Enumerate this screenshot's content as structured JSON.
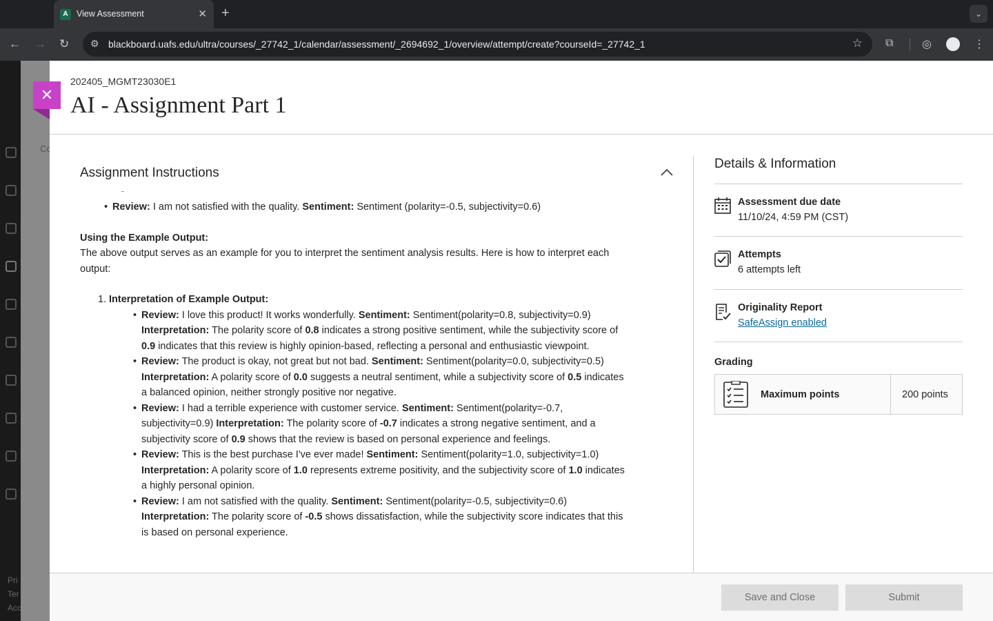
{
  "browser": {
    "tab_title": "View Assessment",
    "favicon_letter": "A",
    "url": "blackboard.uafs.edu/ultra/courses/_27742_1/calendar/assessment/_2694692_1/overview/attempt/create?courseId=_27742_1"
  },
  "background": {
    "side_letters": [
      "Pri",
      "Ter",
      "Acc"
    ],
    "strip_label": "Co"
  },
  "page": {
    "course_code": "202405_MGMT23030E1",
    "title": "AI - Assignment Part 1"
  },
  "instructions": {
    "section_title": "Assignment Instructions",
    "top_item": {
      "review_label": "Review:",
      "review_text": " I am not satisfied with the quality. ",
      "sentiment_label": "Sentiment:",
      "sentiment_text": " Sentiment (polarity=-0.5, subjectivity=0.6)"
    },
    "using_heading": "Using the Example Output:",
    "using_text": "The above output serves as an example for you to interpret the sentiment analysis results. Here is how to interpret each output:",
    "list_number": "1.",
    "list_heading": "Interpretation of Example Output:",
    "items": [
      {
        "review_label": "Review:",
        "review": " I love this product! It works wonderfully. ",
        "sentiment_label": "Sentiment:",
        "sentiment": " Sentiment(polarity=0.8, subjectivity=0.9) ",
        "interp_label": "Interpretation:",
        "t1": " The polarity score of ",
        "v1": "0.8",
        "t2": " indicates a strong positive sentiment, while the subjectivity score of ",
        "v2": "0.9",
        "t3": " indicates that this review is highly opinion-based, reflecting a personal and enthusiastic viewpoint."
      },
      {
        "review_label": "Review:",
        "review": " The product is okay, not great but not bad. ",
        "sentiment_label": "Sentiment:",
        "sentiment": " Sentiment(polarity=0.0, subjectivity=0.5) ",
        "interp_label": "Interpretation:",
        "t1": " A polarity score of ",
        "v1": "0.0",
        "t2": " suggests a neutral sentiment, while a subjectivity score of ",
        "v2": "0.5",
        "t3": " indicates a balanced opinion, neither strongly positive nor negative."
      },
      {
        "review_label": "Review:",
        "review": " I had a terrible experience with customer service. ",
        "sentiment_label": "Sentiment:",
        "sentiment": " Sentiment(polarity=-0.7, subjectivity=0.9) ",
        "interp_label": "Interpretation:",
        "t1": " The polarity score of ",
        "v1": "-0.7",
        "t2": " indicates a strong negative sentiment, and a subjectivity score of ",
        "v2": "0.9",
        "t3": " shows that the review is based on personal experience and feelings."
      },
      {
        "review_label": "Review:",
        "review": " This is the best purchase I've ever made! ",
        "sentiment_label": "Sentiment:",
        "sentiment": " Sentiment(polarity=1.0, subjectivity=1.0) ",
        "interp_label": "Interpretation:",
        "t1": " A polarity score of ",
        "v1": "1.0",
        "t2": " represents extreme positivity, and the subjectivity score of ",
        "v2": "1.0",
        "t3": " indicates a highly personal opinion."
      },
      {
        "review_label": "Review:",
        "review": " I am not satisfied with the quality. ",
        "sentiment_label": "Sentiment:",
        "sentiment": " Sentiment(polarity=-0.5, subjectivity=0.6) ",
        "interp_label": "Interpretation:",
        "t1": " The polarity score of ",
        "v1": "-0.5",
        "t2": " shows dissatisfaction, while the subjectivity score indicates that this is based on personal experience.",
        "v2": "",
        "t3": ""
      }
    ]
  },
  "details": {
    "title": "Details & Information",
    "due_label": "Assessment due date",
    "due_value": "11/10/24, 4:59 PM (CST)",
    "attempts_label": "Attempts",
    "attempts_value": "6 attempts left",
    "originality_label": "Originality Report",
    "originality_link": "SafeAssign enabled",
    "grading_label": "Grading",
    "max_points_label": "Maximum points",
    "max_points_value": "200 points"
  },
  "footer": {
    "save_label": "Save and Close",
    "submit_label": "Submit"
  },
  "colors": {
    "close_button": "#c842c8",
    "link": "#0b6aa1",
    "button_disabled_bg": "#dcdcdc"
  }
}
